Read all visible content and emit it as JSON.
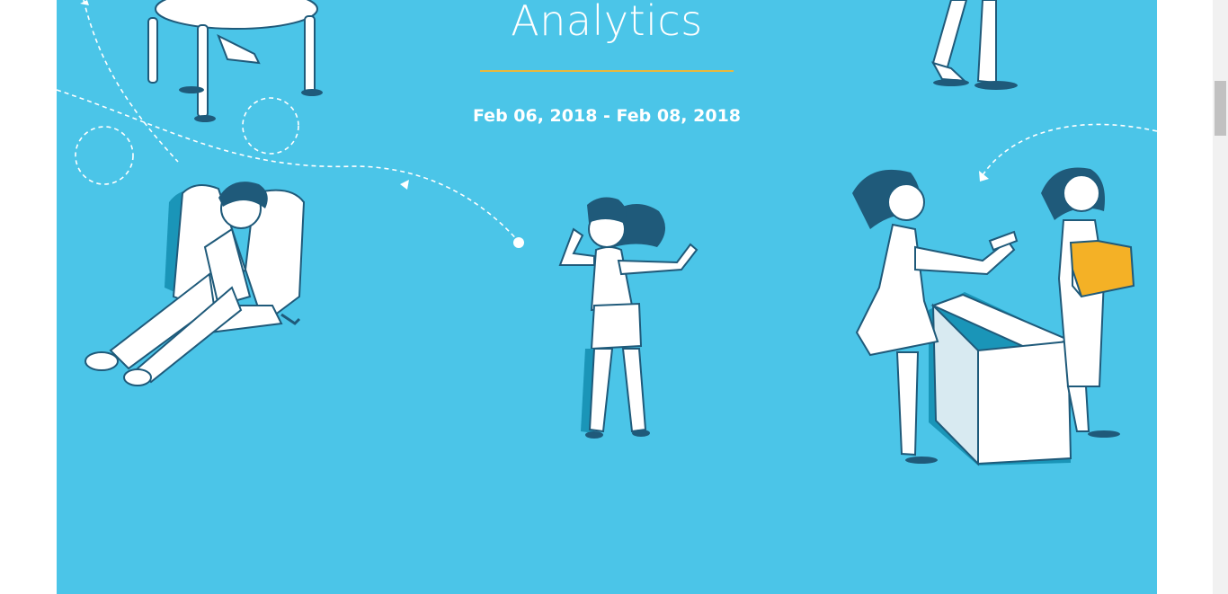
{
  "hero": {
    "title": "Analytics",
    "date_range": "Feb 06, 2018 - Feb 08, 2018"
  },
  "colors": {
    "background": "#4bc5e8",
    "accent_rule": "#e9b83c",
    "figure_fill": "#ffffff",
    "figure_shadow": "#1a95b8",
    "hair": "#1f5a7a",
    "box_yellow": "#f4b126"
  },
  "illustration": {
    "icons": [
      "table-with-people-icon",
      "person-relaxing-in-chair-icon",
      "woman-on-phone-icon",
      "standing-person-icon",
      "two-women-at-desk-icon",
      "dashed-flight-path-icon"
    ]
  }
}
